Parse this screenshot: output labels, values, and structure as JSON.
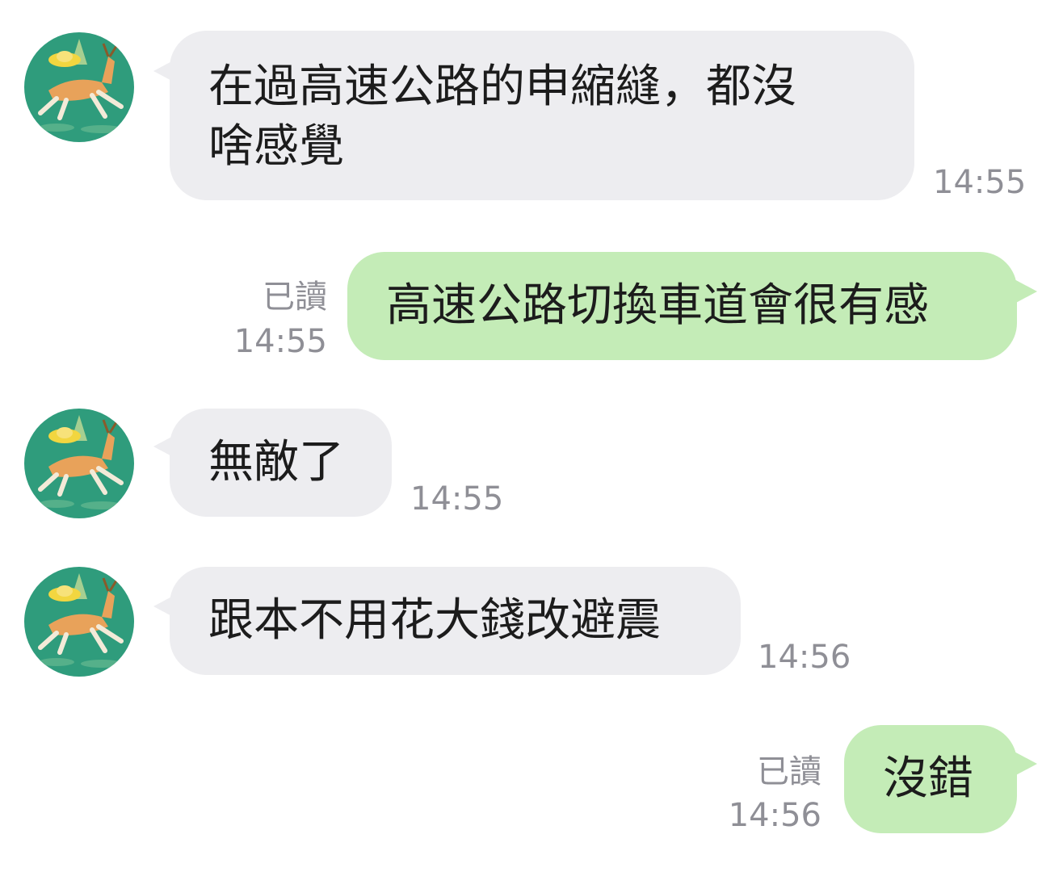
{
  "colors": {
    "incoming_bubble": "#ededf0",
    "outgoing_bubble": "#c4ecb7",
    "meta_text": "#8f8f96",
    "avatar_background": "#2f9c7c"
  },
  "contact": {
    "avatar_icon": "leaping-deer-with-gold-ingot-icon"
  },
  "messages": [
    {
      "direction": "incoming",
      "text": "在過高速公路的申縮縫，都沒\n啥感覺",
      "time": "14:55"
    },
    {
      "direction": "outgoing",
      "text": "高速公路切換車道會很有感",
      "read": "已讀",
      "time": "14:55"
    },
    {
      "direction": "incoming",
      "text": "無敵了",
      "time": "14:55"
    },
    {
      "direction": "incoming",
      "text": "跟本不用花大錢改避震",
      "time": "14:56"
    },
    {
      "direction": "outgoing",
      "text": "沒錯",
      "read": "已讀",
      "time": "14:56"
    }
  ]
}
